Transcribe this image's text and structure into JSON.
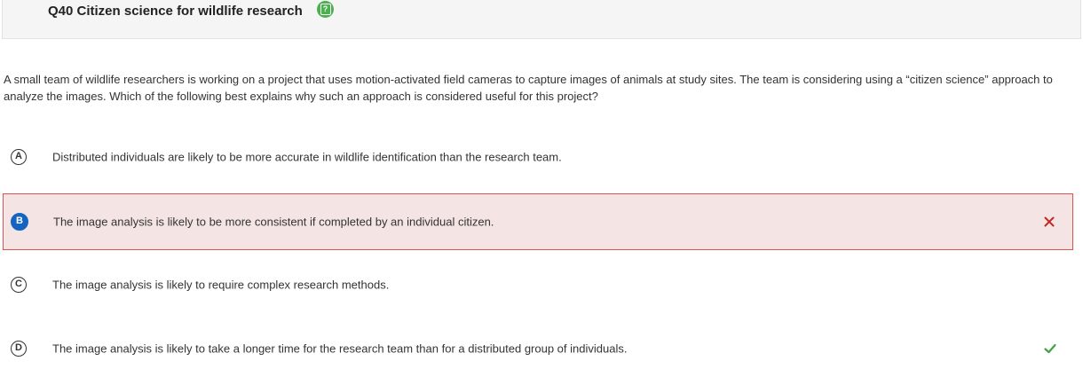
{
  "question": {
    "title": "Q40 Citizen science for wildlife research",
    "help_glyph": "?",
    "stem": "A small team of wildlife researchers is working on a project that uses motion-activated field cameras to capture images of animals at study sites. The team is considering using a “citizen science” approach to analyze the images. Which of the following best explains why such an approach is considered useful for this project?"
  },
  "choices": [
    {
      "letter": "A",
      "text": "Distributed individuals are likely to be more accurate in wildlife identification than the research team.",
      "state": "none"
    },
    {
      "letter": "B",
      "text": "The image analysis is likely to be more consistent if completed by an individual citizen.",
      "state": "selected-incorrect"
    },
    {
      "letter": "C",
      "text": "The image analysis is likely to require complex research methods.",
      "state": "none"
    },
    {
      "letter": "D",
      "text": "The image analysis is likely to take a longer time for the research team than for a distributed group of individuals.",
      "state": "correct"
    }
  ],
  "colors": {
    "selected_letter_bg": "#1565c0",
    "incorrect_bg": "#f5e4e4",
    "incorrect_border": "#d9534f",
    "incorrect_mark": "#c62828",
    "correct_mark": "#43a047",
    "help_icon": "#4caf50"
  },
  "icons": {
    "help": "help-icon",
    "incorrect": "x-mark-icon",
    "correct": "check-mark-icon"
  }
}
